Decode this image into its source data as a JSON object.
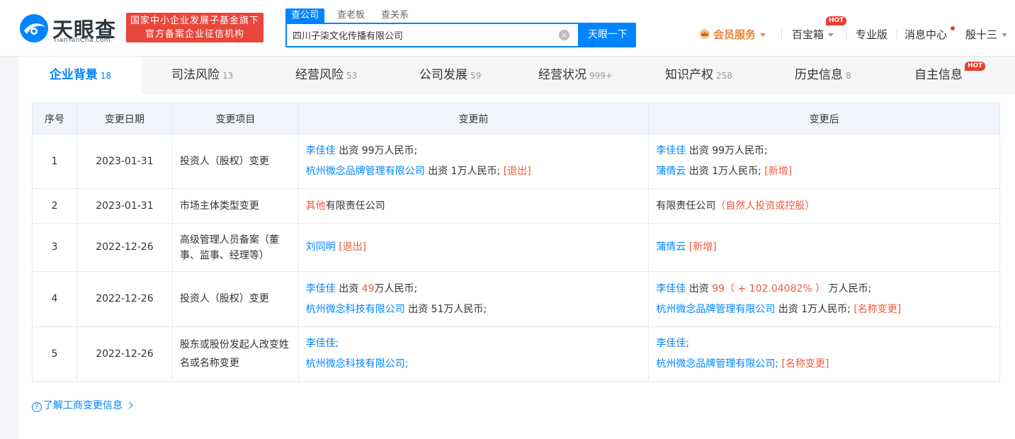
{
  "logo": {
    "name": "天眼查",
    "domain": "TianYanCha.com"
  },
  "badge": {
    "line1": "国家中小企业发展子基金旗下",
    "line2": "官方备案企业征信机构"
  },
  "search": {
    "tabs": [
      "查公司",
      "查老板",
      "查关系"
    ],
    "value": "四川子柒文化传播有限公司",
    "button": "天眼一下"
  },
  "nav": {
    "vip": "会员服务",
    "toolbox": "百宝箱",
    "toolbox_hot": "HOT",
    "pro": "专业版",
    "messages": "消息中心",
    "user": "殷十三"
  },
  "tabs": [
    {
      "label": "企业背景",
      "count": "18"
    },
    {
      "label": "司法风险",
      "count": "13"
    },
    {
      "label": "经营风险",
      "count": "53"
    },
    {
      "label": "公司发展",
      "count": "59"
    },
    {
      "label": "经营状况",
      "count": "999+"
    },
    {
      "label": "知识产权",
      "count": "258"
    },
    {
      "label": "历史信息",
      "count": "8"
    },
    {
      "label": "自主信息",
      "count": "",
      "hot": "HOT"
    }
  ],
  "table": {
    "headers": [
      "序号",
      "变更日期",
      "变更项目",
      "变更前",
      "变更后"
    ],
    "rows": [
      {
        "no": "1",
        "date": "2023-01-31",
        "item": "投资人（股权）变更",
        "before": [
          {
            "name": "李佳佳",
            "text": " 出资 99万人民币;"
          },
          {
            "name": "杭州微念品牌管理有限公司",
            "text": " 出资 1万人民币; ",
            "tag": "[退出]"
          }
        ],
        "after": [
          {
            "name": "李佳佳",
            "text": " 出资 99万人民币;"
          },
          {
            "name": "蒲倩云",
            "text": " 出资 1万人民币; ",
            "tag": "[新增]"
          }
        ]
      },
      {
        "no": "2",
        "date": "2023-01-31",
        "item": "市场主体类型变更",
        "before_red": "其他",
        "before_rest": "有限责任公司",
        "after_main": "有限责任公司",
        "after_red": "（自然人投资或控股）"
      },
      {
        "no": "3",
        "date": "2022-12-26",
        "item": "高级管理人员备案（董事、监事、经理等）",
        "before_name": "刘同明",
        "before_tag": "[退出]",
        "after_name": "蒲倩云",
        "after_tag": "[新增]"
      },
      {
        "no": "4",
        "date": "2022-12-26",
        "item": "投资人（股权）变更",
        "before": [
          {
            "name": "李佳佳",
            "t1": " 出资 ",
            "red": "49",
            "t2": "万人民币;"
          },
          {
            "name": "杭州微念科技有限公司",
            "t1": " 出资 51万人民币;"
          }
        ],
        "after1_name": "李佳佳",
        "after1_t1": " 出资 ",
        "after1_red": "99（ + 102.04082% ）",
        "after1_t2": " 万人民币;",
        "after2_name": "杭州微念品牌管理有限公司",
        "after2_text": " 出资 1万人民币; ",
        "after2_tag": "[名称变更]"
      },
      {
        "no": "5",
        "date": "2022-12-26",
        "item": "股东或股份发起人改变姓名或名称变更",
        "before1": "李佳佳;",
        "before2": "杭州微念科技有限公司;",
        "after1": "李佳佳;",
        "after2": "杭州微念品牌管理有限公司;",
        "after_tag": "[名称变更]"
      }
    ]
  },
  "help_link": "了解工商变更信息",
  "colors": {
    "primary": "#0084ff",
    "red": "#f05a3c",
    "vip": "#e8843c",
    "badge": "#e8473c"
  }
}
